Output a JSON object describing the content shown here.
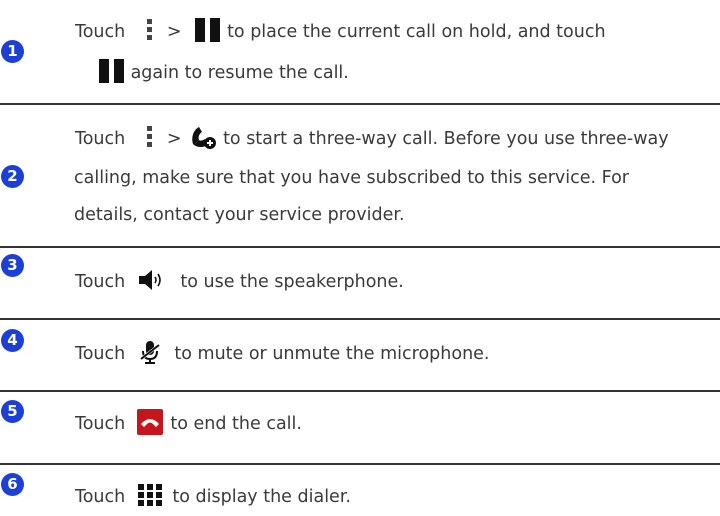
{
  "steps": [
    {
      "number": "1",
      "touch": "Touch",
      "gt": ">",
      "line1_rest": "to place the current call on hold, and touch",
      "line2_rest": "again to resume the call.",
      "icons": [
        "menu-icon",
        "pause-icon",
        "pause-icon"
      ]
    },
    {
      "number": "2",
      "touch": "Touch",
      "gt": ">",
      "line1_rest": "to start a three-way call. Before you use three-way",
      "line2": "calling, make sure that you have subscribed to this service. For",
      "line3": "details, contact your service provider.",
      "icons": [
        "menu-icon",
        "add-call-icon"
      ]
    },
    {
      "number": "3",
      "touch": "Touch",
      "rest": "to use the speakerphone.",
      "icons": [
        "speaker-icon"
      ]
    },
    {
      "number": "4",
      "touch": "Touch",
      "rest": "to mute or unmute the microphone.",
      "icons": [
        "mute-microphone-icon"
      ]
    },
    {
      "number": "5",
      "touch": "Touch",
      "rest": "to end the call.",
      "icons": [
        "end-call-icon"
      ]
    },
    {
      "number": "6",
      "touch": "Touch",
      "rest": "to display the dialer.",
      "icons": [
        "dialer-icon"
      ]
    }
  ],
  "colors": {
    "badge": "#1c3fd6",
    "end_call": "#c4161c",
    "divider": "#333333",
    "text": "#3a3a3a"
  }
}
